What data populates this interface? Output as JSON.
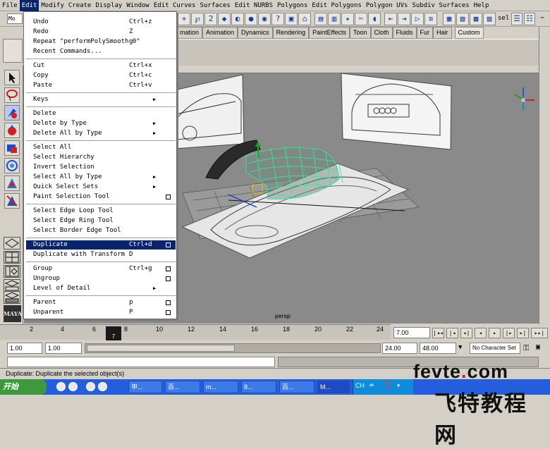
{
  "menubar": {
    "items": [
      "File",
      "Edit",
      "Modify",
      "Create",
      "Display",
      "Window",
      "Edit Curves",
      "Surfaces",
      "Edit NURBS",
      "Polygons",
      "Edit Polygons",
      "Polygon UVs",
      "Subdiv Surfaces",
      "Help"
    ]
  },
  "status_line": {
    "mode_field": "Mo",
    "sel_label": "sel",
    "prefix": "−"
  },
  "shelf": {
    "tabs": [
      "mation",
      "Animation",
      "Dynamics",
      "Rendering",
      "PaintEffects",
      "Toon",
      "Cloth",
      "Fluids",
      "Fur",
      "Hair",
      "Custom"
    ]
  },
  "viewport": {
    "panel_name": "persp"
  },
  "timeline": {
    "ticks": [
      "2",
      "4",
      "6",
      "8",
      "10",
      "12",
      "14",
      "16",
      "18",
      "20",
      "22",
      "24"
    ],
    "current_frame_marker": "7",
    "current_time": "7.00"
  },
  "range": {
    "start_time": "1.00",
    "playback_start": "1.00",
    "playback_end": "24.00",
    "end_time": "48.00",
    "character_set": "No Character Set"
  },
  "help_line": "Duplicate: Duplicate the selected object(s)",
  "edit_menu": {
    "items": [
      {
        "label": "Undo",
        "shortcut": "Ctrl+z"
      },
      {
        "label": "Redo",
        "shortcut": "Z"
      },
      {
        "label": "Repeat \"performPolySmooth 0\"",
        "shortcut": "g"
      },
      {
        "label": "Recent Commands..."
      },
      {
        "label": "Cut",
        "shortcut": "Ctrl+x"
      },
      {
        "label": "Copy",
        "shortcut": "Ctrl+c"
      },
      {
        "label": "Paste",
        "shortcut": "Ctrl+v"
      },
      {
        "label": "Keys",
        "submenu": true
      },
      {
        "label": "Delete"
      },
      {
        "label": "Delete by Type",
        "submenu": true
      },
      {
        "label": "Delete All by Type",
        "submenu": true
      },
      {
        "label": "Select All"
      },
      {
        "label": "Select Hierarchy"
      },
      {
        "label": "Invert Selection"
      },
      {
        "label": "Select All by Type",
        "submenu": true
      },
      {
        "label": "Quick Select Sets",
        "submenu": true
      },
      {
        "label": "Paint Selection Tool",
        "option_box": true
      },
      {
        "label": "Select Edge Loop Tool"
      },
      {
        "label": "Select Edge Ring Tool"
      },
      {
        "label": "Select Border Edge Tool"
      },
      {
        "label": "Duplicate",
        "shortcut": "Ctrl+d",
        "option_box": true,
        "highlighted": true
      },
      {
        "label": "Duplicate with Transform",
        "shortcut": "D"
      },
      {
        "label": "Group",
        "shortcut": "Ctrl+g",
        "option_box": true
      },
      {
        "label": "Ungroup",
        "option_box": true
      },
      {
        "label": "Level of Detail",
        "submenu": true
      },
      {
        "label": "Parent",
        "shortcut": "p",
        "option_box": true
      },
      {
        "label": "Unparent",
        "shortcut": "P",
        "option_box": true
      }
    ]
  },
  "taskbar": {
    "start_label": "开始",
    "tasks": [
      "甲...",
      "百...",
      "m...",
      "8...",
      "百...",
      "M..."
    ],
    "language": "CH"
  },
  "watermark": {
    "line1": "fevte",
    "line1_dot": ".",
    "line1_end": "com",
    "line2": "飞特教程网"
  },
  "colors": {
    "menu_highlight": "#0a246a",
    "ui_gray": "#d4d0c8",
    "viewport_gray": "#8a8a8a",
    "mesh_green": "#3ee0a0",
    "taskbar_blue": "#245edc"
  }
}
